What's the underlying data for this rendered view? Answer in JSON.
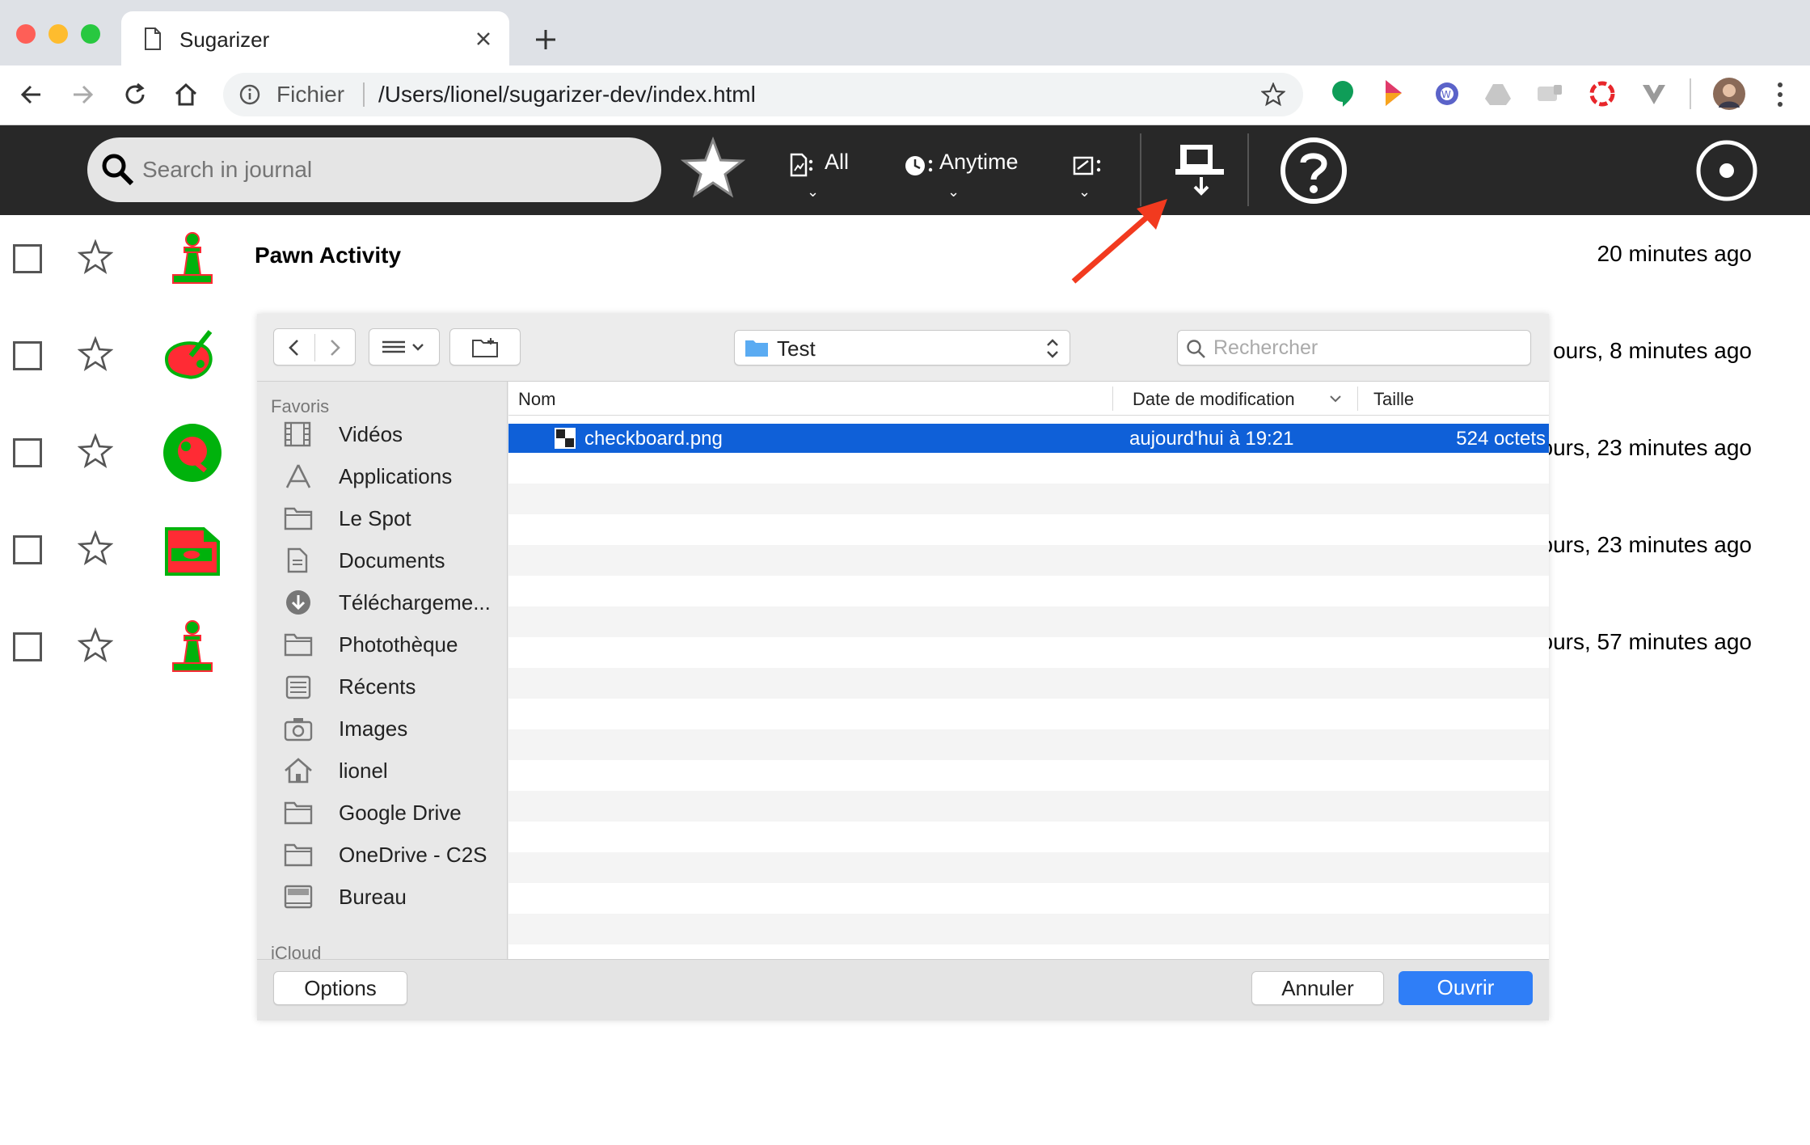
{
  "browser": {
    "tab_title": "Sugarizer",
    "url_scheme": "Fichier",
    "url_path": "/Users/lionel/sugarizer-dev/index.html"
  },
  "journal": {
    "search_placeholder": "Search in journal",
    "filter_type_label": "All",
    "filter_time_label": "Anytime",
    "entries": [
      {
        "title": "Pawn Activity",
        "time": "20 minutes ago",
        "icon": "pawn-icon"
      },
      {
        "title": "",
        "time": "ours, 8 minutes ago",
        "icon": "paint-icon"
      },
      {
        "title": "",
        "time": "ours, 23 minutes ago",
        "icon": "abacus-icon"
      },
      {
        "title": "",
        "time": "ours, 23 minutes ago",
        "icon": "video-icon"
      },
      {
        "title": "",
        "time": "ours, 57 minutes ago",
        "icon": "pawn-icon"
      }
    ]
  },
  "dialog": {
    "location": "Test",
    "search_placeholder": "Rechercher",
    "sidebar_heading": "Favoris",
    "sidebar_heading_2": "iCloud",
    "sidebar_items": [
      {
        "label": "Vidéos",
        "icon": "film-icon"
      },
      {
        "label": "Applications",
        "icon": "applications-icon"
      },
      {
        "label": "Le Spot",
        "icon": "folder-icon"
      },
      {
        "label": "Documents",
        "icon": "documents-icon"
      },
      {
        "label": "Téléchargeme...",
        "icon": "download-icon"
      },
      {
        "label": "Photothèque",
        "icon": "folder-icon"
      },
      {
        "label": "Récents",
        "icon": "recents-icon"
      },
      {
        "label": "Images",
        "icon": "camera-icon"
      },
      {
        "label": "lionel",
        "icon": "home-icon"
      },
      {
        "label": "Google Drive",
        "icon": "folder-icon"
      },
      {
        "label": "OneDrive - C2S",
        "icon": "folder-icon"
      },
      {
        "label": "Bureau",
        "icon": "desktop-icon"
      }
    ],
    "columns": {
      "name": "Nom",
      "date": "Date de modification",
      "size": "Taille"
    },
    "files": [
      {
        "name": "checkboard.png",
        "date": "aujourd'hui à 19:21",
        "size": "524 octets",
        "selected": true
      }
    ],
    "options_label": "Options",
    "cancel_label": "Annuler",
    "open_label": "Ouvrir"
  },
  "colors": {
    "sugar_toolbar": "#282828",
    "selection_blue": "#0f60d8",
    "activity_green": "#00b20c",
    "activity_red": "#ff2b34",
    "annotation_arrow": "#f23a1f"
  }
}
